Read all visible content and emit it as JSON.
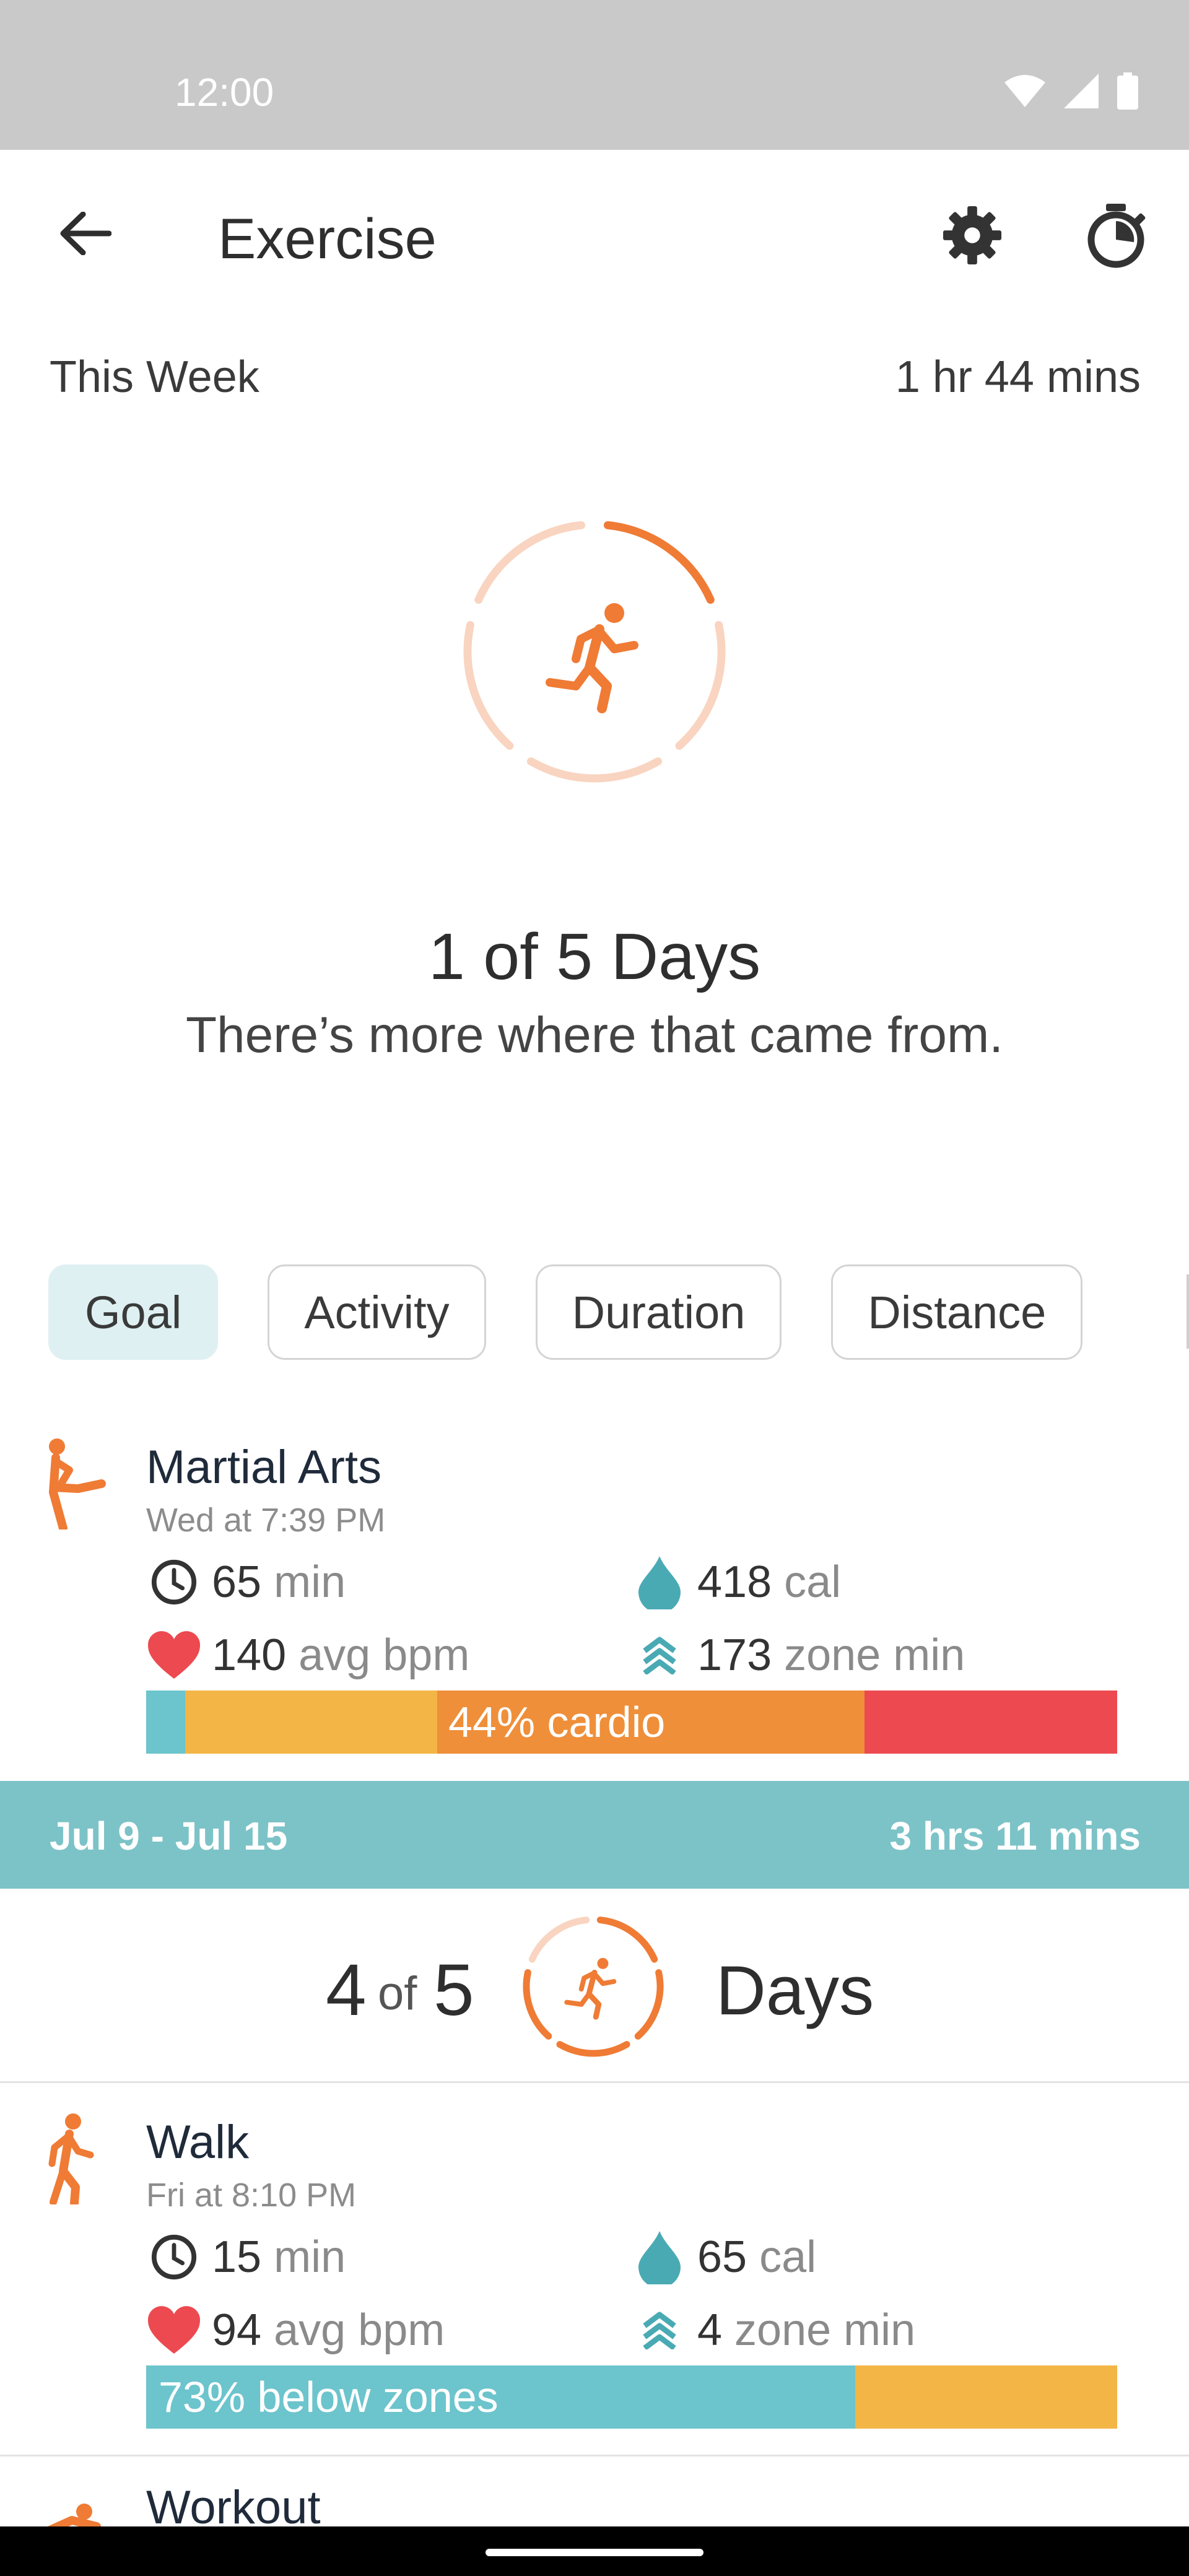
{
  "status_bar": {
    "time": "12:00"
  },
  "app_bar": {
    "title": "Exercise"
  },
  "summary": {
    "week_label": "This Week",
    "week_total": "1 hr 44 mins",
    "days_headline": "1 of 5 Days",
    "days_subtext": "There’s more where that came from.",
    "progress_fraction": 0.2
  },
  "chips": [
    {
      "label": "Goal",
      "selected": true
    },
    {
      "label": "Activity",
      "selected": false
    },
    {
      "label": "Duration",
      "selected": false
    },
    {
      "label": "Distance",
      "selected": false
    }
  ],
  "entries": [
    {
      "title": "Martial Arts",
      "time": "Wed at 7:39 PM",
      "icon": "martial-arts-icon",
      "duration_value": "65",
      "duration_unit": "min",
      "calories_value": "418",
      "calories_unit": "cal",
      "heart_value": "140",
      "heart_unit": "avg bpm",
      "zone_value": "173",
      "zone_unit": "zone min",
      "zones": [
        {
          "color": "#6cc4cc",
          "fraction": 0.04
        },
        {
          "color": "#f3b545",
          "fraction": 0.26
        },
        {
          "color": "#ef8f3a",
          "fraction": 0.44
        },
        {
          "color": "#ec4a50",
          "fraction": 0.26
        }
      ],
      "zone_label": "44% cardio"
    },
    {
      "title": "Walk",
      "time": "Fri at 8:10 PM",
      "icon": "walk-icon",
      "duration_value": "15",
      "duration_unit": "min",
      "calories_value": "65",
      "calories_unit": "cal",
      "heart_value": "94",
      "heart_unit": "avg bpm",
      "zone_value": "4",
      "zone_unit": "zone min",
      "zones": [
        {
          "color": "#6cc4cc",
          "fraction": 0.73
        },
        {
          "color": "#f3b545",
          "fraction": 0.27
        }
      ],
      "zone_label": "73% below zones"
    },
    {
      "title": "Workout",
      "icon": "workout-icon"
    }
  ],
  "week_band": {
    "range": "Jul 9 - Jul 15",
    "total": "3 hrs 11 mins"
  },
  "week_row": {
    "count": "4",
    "of": "of",
    "goal": "5",
    "days": "Days",
    "progress_fraction": 0.8
  },
  "colors": {
    "accent_orange": "#ef7b35",
    "ring_faded": "#f9d4c0",
    "teal": "#7cc3c8",
    "drop_teal": "#4aaab4",
    "heart_red": "#ec4a50"
  }
}
